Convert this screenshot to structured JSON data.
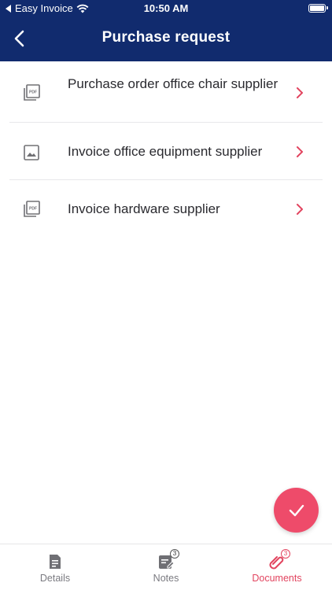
{
  "status_bar": {
    "back_app": "Easy Invoice",
    "time": "10:50 AM"
  },
  "nav": {
    "title": "Purchase request"
  },
  "documents": [
    {
      "title": "Purchase order office chair supplier",
      "icon": "pdf-icon"
    },
    {
      "title": "Invoice office equipment supplier",
      "icon": "image-icon"
    },
    {
      "title": "Invoice hardware supplier",
      "icon": "pdf-icon"
    }
  ],
  "tabs": [
    {
      "label": "Details",
      "icon": "document-icon",
      "badge": ""
    },
    {
      "label": "Notes",
      "icon": "note-edit-icon",
      "badge": "3"
    },
    {
      "label": "Documents",
      "icon": "paperclip-icon",
      "badge": "3"
    }
  ],
  "colors": {
    "header": "#112B6E",
    "accent": "#EE4B6A"
  }
}
